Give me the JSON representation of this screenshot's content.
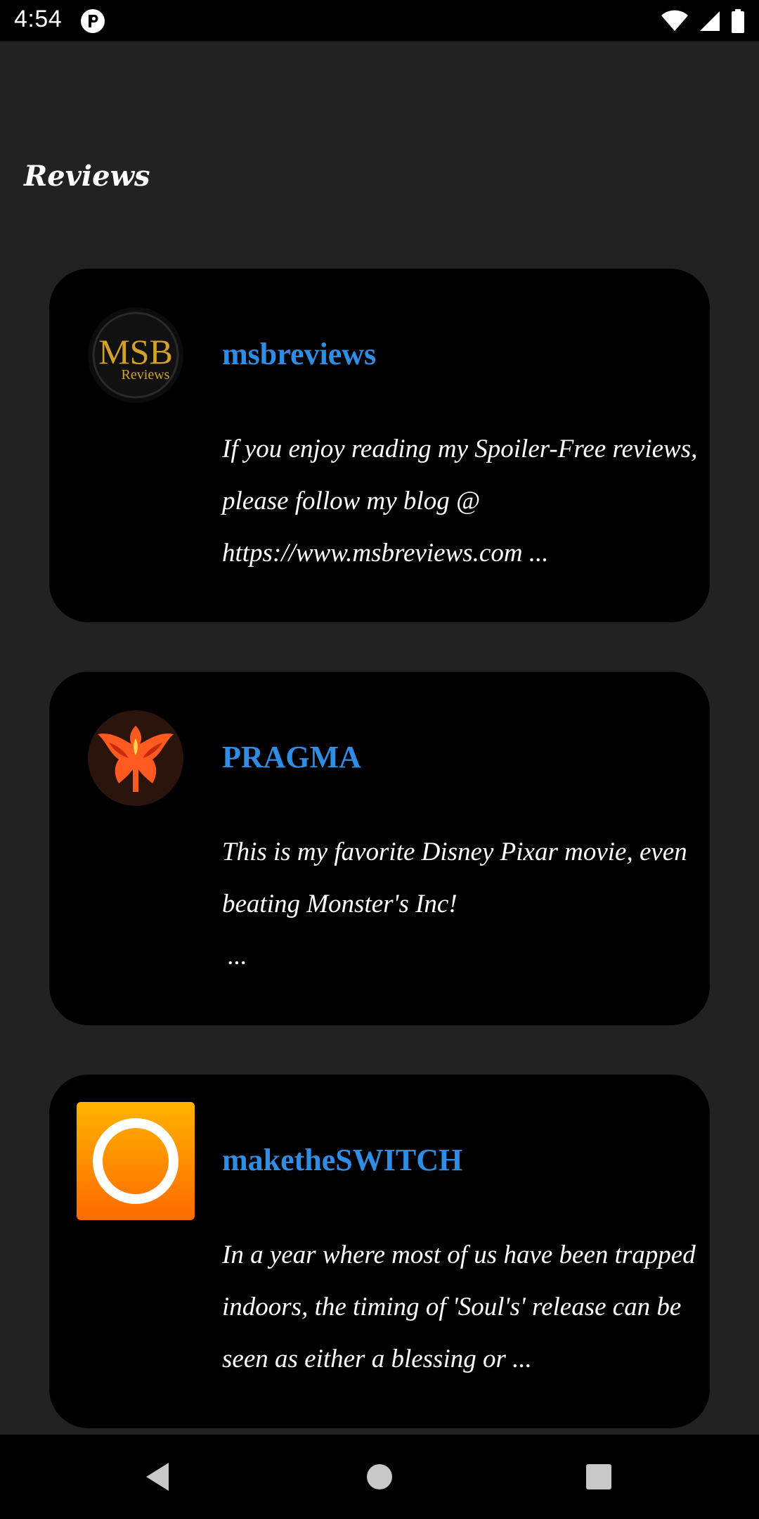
{
  "status_bar": {
    "time": "4:54",
    "icons": [
      "app-notification-icon",
      "wifi-icon",
      "cellular-signal-icon",
      "battery-icon"
    ]
  },
  "page": {
    "section_title": "Reviews"
  },
  "reviews": [
    {
      "author": "msbreviews",
      "avatar_text": "MSB",
      "avatar_subtext": "Reviews",
      "text": "If you enjoy reading my Spoiler-Free reviews, please follow my blog @ https://www.msbreviews.com ..."
    },
    {
      "author": "PRAGMA",
      "avatar_icon": "phoenix-logo-icon",
      "text": "This is my favorite Disney Pixar movie, even beating Monster's Inc!",
      "more": "..."
    },
    {
      "author": "maketheSWITCH",
      "avatar_icon": "orange-ring-logo-icon",
      "text": "In a year where most of us have been trapped indoors, the timing of 'Soul's' release can be seen as either a blessing or ..."
    }
  ],
  "nav_bar": {
    "buttons": [
      "back-icon",
      "home-icon",
      "recents-icon"
    ]
  },
  "colors": {
    "background": "#222223",
    "card": "#000000",
    "author": "#2f8de4",
    "text": "#ffffff",
    "msb_gold": "#d4a12a",
    "orange_logo": "#ff8a00"
  }
}
